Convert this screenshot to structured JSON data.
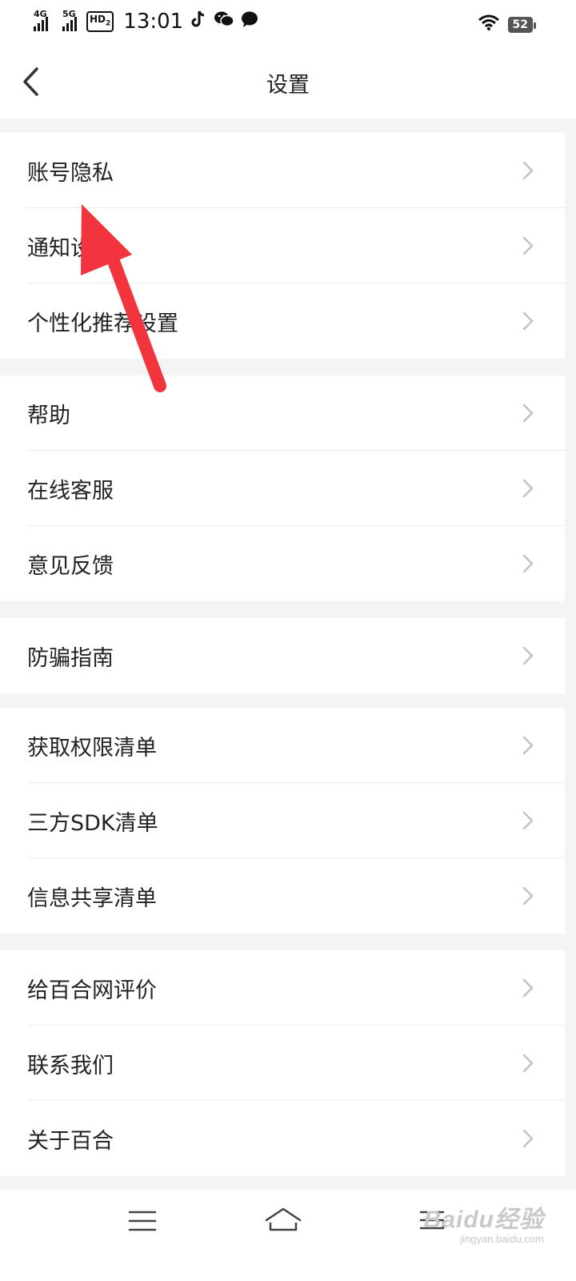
{
  "status_bar": {
    "signal_1": "4G",
    "signal_2": "5G",
    "hd_label": "HD",
    "hd_sub": "2",
    "time": "13:01",
    "battery": "52"
  },
  "header": {
    "title": "设置"
  },
  "groups": [
    {
      "items": [
        {
          "label": "账号隐私"
        },
        {
          "label": "通知设置"
        },
        {
          "label": "个性化推荐设置"
        }
      ]
    },
    {
      "items": [
        {
          "label": "帮助"
        },
        {
          "label": "在线客服"
        },
        {
          "label": "意见反馈"
        }
      ]
    },
    {
      "items": [
        {
          "label": "防骗指南"
        }
      ]
    },
    {
      "items": [
        {
          "label": "获取权限清单"
        },
        {
          "label": "三方SDK清单"
        },
        {
          "label": "信息共享清单"
        }
      ]
    },
    {
      "items": [
        {
          "label": "给百合网评价"
        },
        {
          "label": "联系我们"
        },
        {
          "label": "关于百合"
        }
      ]
    }
  ],
  "annotation": {
    "color": "#f2343f"
  },
  "watermark": {
    "main": "Baidu经验",
    "sub": "jingyan.baidu.com"
  }
}
